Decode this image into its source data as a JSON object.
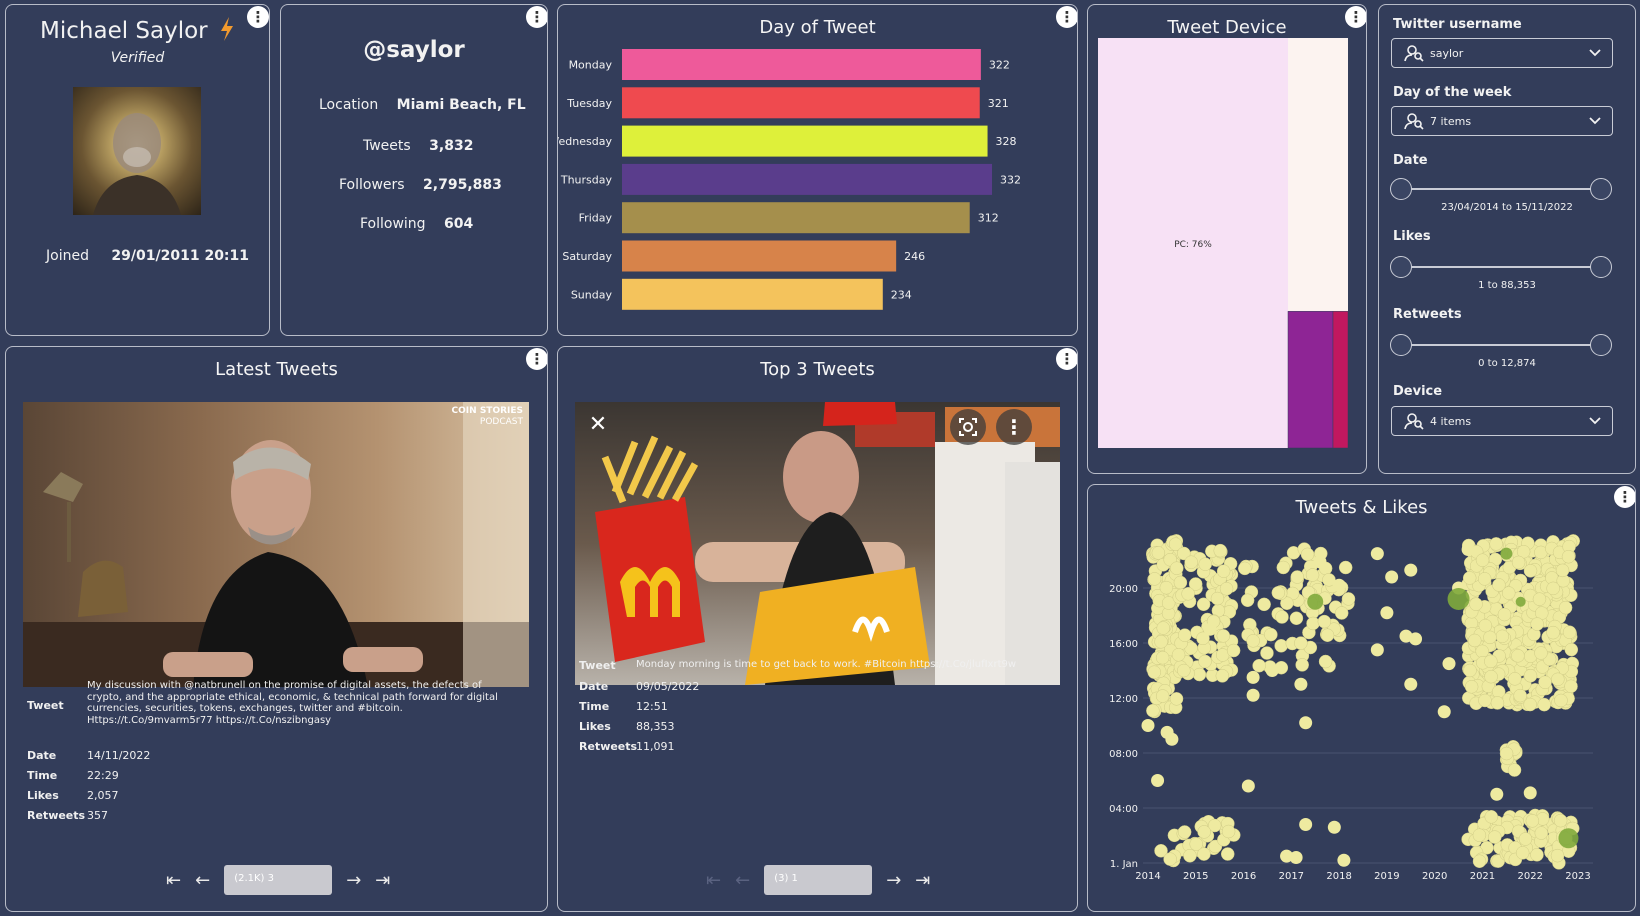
{
  "profile": {
    "name": "Michael Saylor",
    "verified": "Verified",
    "joined_label": "Joined",
    "joined_value": "29/01/2011 20:11"
  },
  "stats": {
    "handle": "@saylor",
    "location_label": "Location",
    "location_value": "Miami Beach, FL",
    "tweets_label": "Tweets",
    "tweets_value": "3,832",
    "followers_label": "Followers",
    "followers_value": "2,795,883",
    "following_label": "Following",
    "following_value": "604"
  },
  "day_chart": {
    "title": "Day of Tweet",
    "chart_data": {
      "type": "bar",
      "orientation": "horizontal",
      "categories": [
        "Monday",
        "Tuesday",
        "Wednesday",
        "Thursday",
        "Friday",
        "Saturday",
        "Sunday"
      ],
      "values": [
        322,
        321,
        328,
        332,
        312,
        246,
        234
      ],
      "colors": [
        "#ee5a9a",
        "#ef4a4f",
        "#def03a",
        "#5a3d8c",
        "#a58f4c",
        "#d7834a",
        "#f4c35c"
      ]
    }
  },
  "device_chart": {
    "title": "Tweet Device",
    "chart_data": {
      "type": "treemap",
      "label": "PC: 76%",
      "segments": [
        {
          "share": 0.76,
          "color": "#f7e1f5"
        },
        {
          "share": 0.16,
          "color": "#fcf3f0"
        },
        {
          "share": 0.06,
          "color": "#8e2595"
        },
        {
          "share": 0.02,
          "color": "#c1185f"
        }
      ]
    }
  },
  "filters": {
    "username_label": "Twitter username",
    "username_value": "saylor",
    "day_label": "Day of the week",
    "day_value": "7 items",
    "date_label": "Date",
    "date_range": "23/04/2014 to 15/11/2022",
    "likes_label": "Likes",
    "likes_range": "1 to 88,353",
    "retweets_label": "Retweets",
    "retweets_range": "0 to 12,874",
    "device_label": "Device",
    "device_value": "4 items"
  },
  "latest": {
    "title": "Latest Tweets",
    "image_caption_1": "COIN STORIES",
    "image_caption_2": "PODCAST",
    "tweet_label": "Tweet",
    "tweet_value": "My discussion with @natbrunell on the promise of digital assets, the defects of crypto, and the appropriate ethical, economic, & technical path forward for digital currencies, securities, tokens, exchanges, twitter and #bitcoin. Https://t.Co/9mvarm5r77 https://t.Co/nszibngasy",
    "date_label": "Date",
    "date_value": "14/11/2022",
    "time_label": "Time",
    "time_value": "22:29",
    "likes_label": "Likes",
    "likes_value": "2,057",
    "retweets_label": "Retweets",
    "retweets_value": "357",
    "pager_value": "(2.1K)  3"
  },
  "top": {
    "title": "Top 3 Tweets",
    "tweet_label": "Tweet",
    "tweet_value": "Monday morning is time to get back to work. #Bitcoin https://t.Co/jlufIxrt9w",
    "date_label": "Date",
    "date_value": "09/05/2022",
    "time_label": "Time",
    "time_value": "12:51",
    "likes_label": "Likes",
    "likes_value": "88,353",
    "retweets_label": "Retweets",
    "retweets_value": "11,091",
    "pager_value": "(3)  1"
  },
  "scatter": {
    "title": "Tweets & Likes",
    "chart_data": {
      "type": "scatter",
      "x_ticks": [
        "2014",
        "2015",
        "2016",
        "2017",
        "2018",
        "2019",
        "2020",
        "2021",
        "2022",
        "2023"
      ],
      "y_ticks": [
        "1. Jan",
        "04:00",
        "08:00",
        "12:00",
        "16:00",
        "20:00"
      ],
      "point_color": "#eeeaa0",
      "highlight_color": "#7faa3c",
      "x_unit": "year",
      "y_unit": "hour_of_day",
      "clusters": [
        {
          "x": [
            2014.1,
            2014.6
          ],
          "y": [
            11.0,
            23.5
          ],
          "n": 140
        },
        {
          "x": [
            2014.6,
            2015.8
          ],
          "y": [
            13.5,
            23.0
          ],
          "n": 90
        },
        {
          "x": [
            2014.2,
            2015.9
          ],
          "y": [
            0.1,
            3.5
          ],
          "n": 30
        },
        {
          "x": [
            2016.0,
            2017.8
          ],
          "y": [
            14.0,
            23.0
          ],
          "n": 60
        },
        {
          "x": [
            2017.3,
            2018.2
          ],
          "y": [
            16.5,
            21.5
          ],
          "n": 25
        },
        {
          "x": [
            2020.7,
            2022.9
          ],
          "y": [
            11.5,
            23.5
          ],
          "n": 420
        },
        {
          "x": [
            2020.7,
            2022.9
          ],
          "y": [
            0.0,
            3.5
          ],
          "n": 90
        },
        {
          "x": [
            2021.5,
            2021.7
          ],
          "y": [
            6.0,
            8.5
          ],
          "n": 12
        }
      ],
      "scattered": [
        [
          2014.4,
          9.5
        ],
        [
          2014.5,
          9.0
        ],
        [
          2014.2,
          6.0
        ],
        [
          2014.0,
          10.0
        ],
        [
          2016.1,
          5.6
        ],
        [
          2015.3,
          17.0
        ],
        [
          2016.2,
          13.5
        ],
        [
          2016.2,
          12.2
        ],
        [
          2016.6,
          14.0
        ],
        [
          2017.3,
          10.2
        ],
        [
          2017.2,
          13.0
        ],
        [
          2017.3,
          2.8
        ],
        [
          2017.9,
          2.6
        ],
        [
          2016.9,
          0.5
        ],
        [
          2017.1,
          0.4
        ],
        [
          2018.8,
          22.5
        ],
        [
          2018.1,
          0.2
        ],
        [
          2019.1,
          20.8
        ],
        [
          2019.0,
          18.2
        ],
        [
          2019.4,
          16.5
        ],
        [
          2018.8,
          15.5
        ],
        [
          2019.6,
          16.3
        ],
        [
          2019.5,
          13.0
        ],
        [
          2019.5,
          21.3
        ],
        [
          2020.5,
          20.0
        ],
        [
          2020.7,
          22.8
        ],
        [
          2020.3,
          14.5
        ],
        [
          2020.2,
          11.0
        ],
        [
          2021.3,
          5.0
        ],
        [
          2022.0,
          5.1
        ],
        [
          2017.6,
          21.9
        ],
        [
          2018.0,
          20.2
        ]
      ],
      "highlights": [
        [
          2020.5,
          19.2,
          11
        ],
        [
          2017.5,
          19.0,
          8
        ],
        [
          2022.8,
          1.8,
          10
        ],
        [
          2021.5,
          22.5,
          6
        ],
        [
          2021.8,
          19.0,
          5
        ]
      ]
    }
  }
}
